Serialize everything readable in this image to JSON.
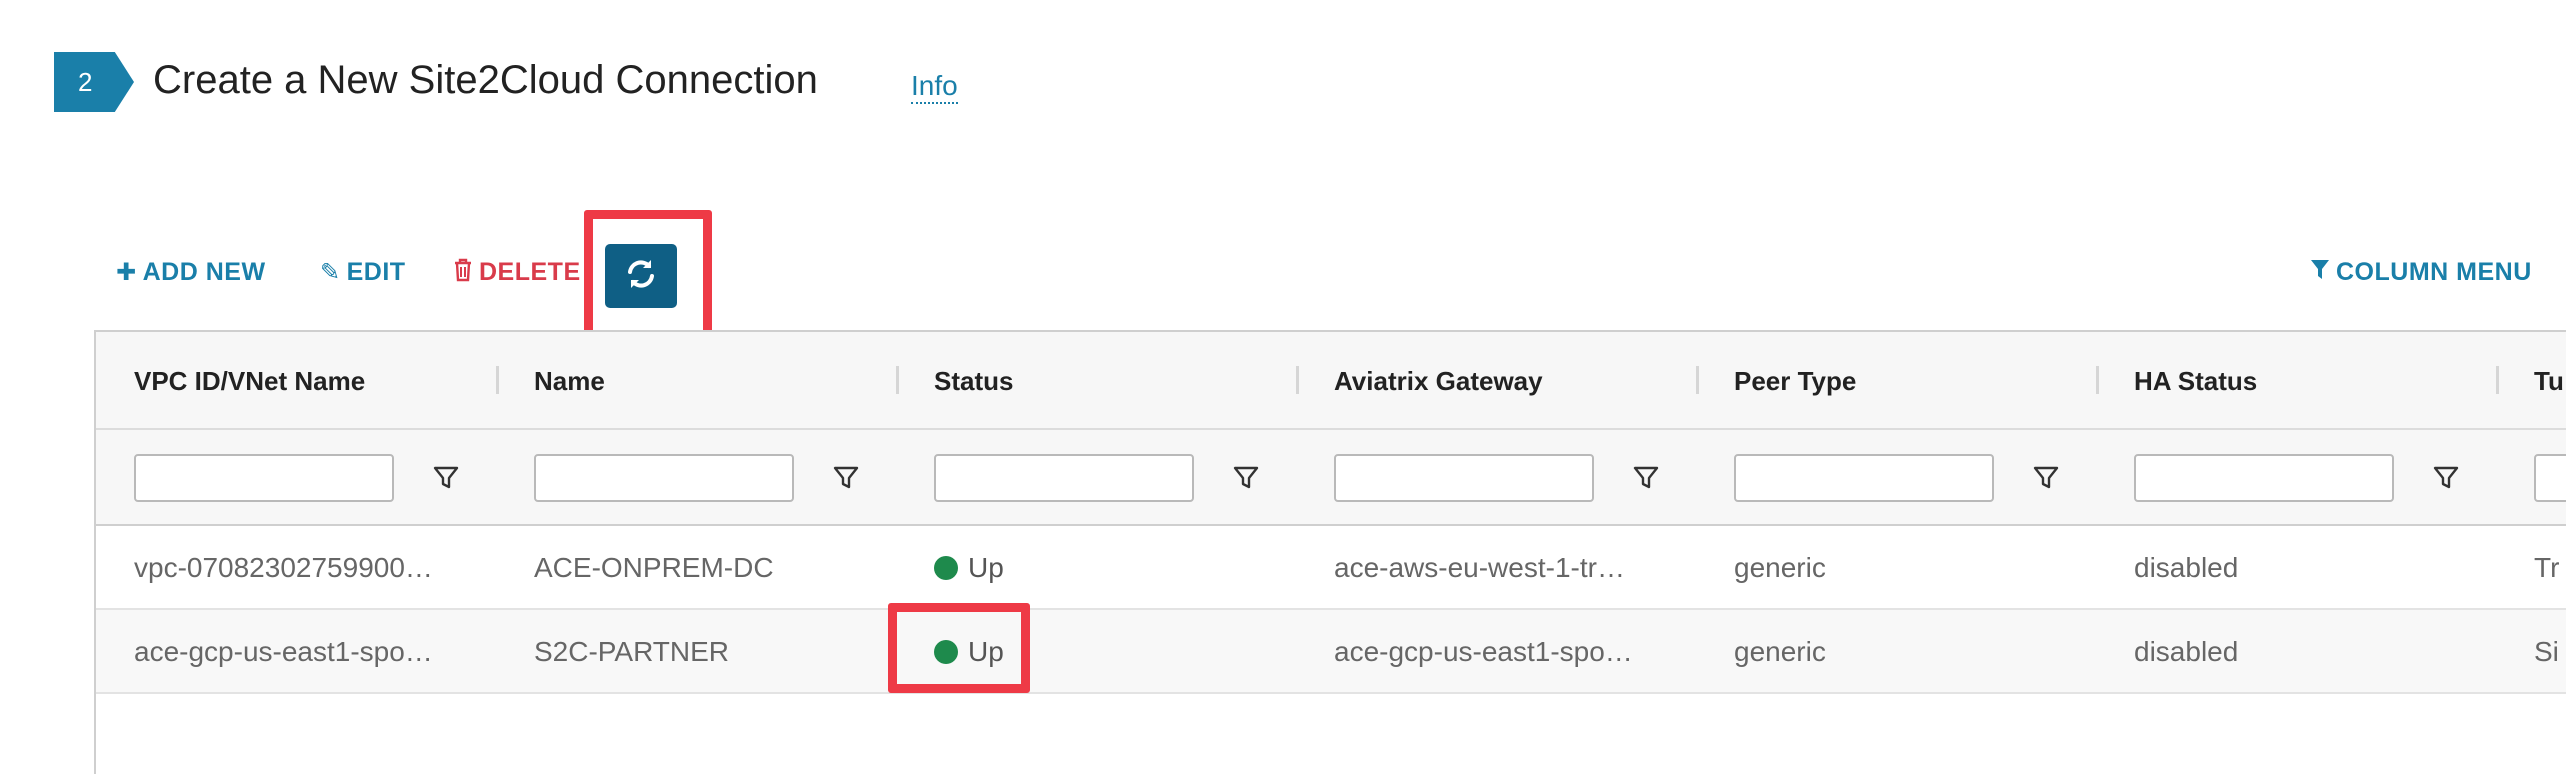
{
  "step": {
    "number": "2",
    "title": "Create a New Site2Cloud Connection",
    "info_label": "Info"
  },
  "toolbar": {
    "add_label": "ADD NEW",
    "edit_label": "EDIT",
    "delete_label": "DELETE",
    "column_menu_label": "COLUMN MENU",
    "icons": {
      "add": "plus-icon",
      "edit": "pencil-icon",
      "delete": "trash-icon",
      "refresh": "refresh-icon",
      "column_menu": "funnel-icon"
    }
  },
  "table": {
    "columns": [
      "VPC ID/VNet Name",
      "Name",
      "Status",
      "Aviatrix Gateway",
      "Peer Type",
      "HA Status",
      "Tu"
    ],
    "rows": [
      {
        "vpc": "vpc-07082302759900…",
        "name": "ACE-ONPREM-DC",
        "status": "Up",
        "gateway": "ace-aws-eu-west-1-tr…",
        "peer_type": "generic",
        "ha_status": "disabled",
        "tunnel": "Tr"
      },
      {
        "vpc": "ace-gcp-us-east1-spo…",
        "name": "S2C-PARTNER",
        "status": "Up",
        "gateway": "ace-gcp-us-east1-spo…",
        "peer_type": "generic",
        "ha_status": "disabled",
        "tunnel": "Si"
      }
    ]
  },
  "colors": {
    "accent": "#1a7fa9",
    "delete": "#d93b4a",
    "refresh_bg": "#0f5f85",
    "highlight": "#ee3a46",
    "status_up": "#1e8a4c"
  }
}
